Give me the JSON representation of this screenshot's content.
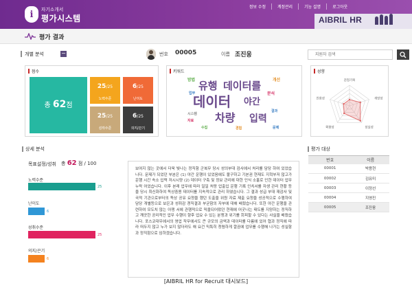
{
  "header": {
    "logo_sub": "자기소개서",
    "logo_main": "평가시스템",
    "nav": [
      "정보 수정",
      "계정관리",
      "기능 설명",
      "로그아웃"
    ],
    "brand": "AIBRIL HR",
    "brand_color": "#7a2f95"
  },
  "page": {
    "title": "평가 결과"
  },
  "individual": {
    "section_label": "개별 분석",
    "collapse_label": "−",
    "id_label": "번호",
    "id_value": "00005",
    "name_label": "이름",
    "name_value": "조진웅",
    "search_placeholder": "지원자 검색"
  },
  "score": {
    "title": "점수",
    "total_prefix": "총 ",
    "total": "62",
    "total_suffix": "점",
    "items": [
      {
        "value": "25",
        "max": "/25",
        "label": "노력수준",
        "color": "#f4a51d"
      },
      {
        "value": "6",
        "max": "/25",
        "label": "난이도",
        "color": "#f06a37"
      },
      {
        "value": "25",
        "max": "/25",
        "label": "성취수준",
        "color": "#c8a97a"
      },
      {
        "value": "6",
        "max": "/25",
        "label": "의지/끈기",
        "color": "#3c3c3c"
      }
    ]
  },
  "keyword": {
    "title": "키워드",
    "words": [
      {
        "text": "데이터",
        "size": 20,
        "color": "#6a4a8c"
      },
      {
        "text": "유행",
        "size": 15,
        "color": "#6a4a8c"
      },
      {
        "text": "데이터를",
        "size": 15,
        "color": "#6a4a8c"
      },
      {
        "text": "야간",
        "size": 13,
        "color": "#6a4a8c"
      },
      {
        "text": "차량",
        "size": 16,
        "color": "#6a4a8c"
      },
      {
        "text": "입력",
        "size": 14,
        "color": "#6a4a8c"
      },
      {
        "text": "방법",
        "size": 6,
        "color": "#5fae4c"
      },
      {
        "text": "개선",
        "size": 6,
        "color": "#e4922b"
      },
      {
        "text": "업무",
        "size": 5,
        "color": "#3b7fc4"
      },
      {
        "text": "분석",
        "size": 6,
        "color": "#d63a6c"
      },
      {
        "text": "시스템",
        "size": 5,
        "color": "#8c8c8c"
      },
      {
        "text": "수집",
        "size": 5,
        "color": "#5fae4c"
      },
      {
        "text": "결과",
        "size": 5,
        "color": "#3b7fc4"
      },
      {
        "text": "경험",
        "size": 5,
        "color": "#e4922b"
      },
      {
        "text": "자료",
        "size": 5,
        "color": "#d63a6c"
      },
      {
        "text": "문제",
        "size": 5,
        "color": "#3b7fc4"
      }
    ]
  },
  "personality": {
    "title": "성향",
    "axes": [
      "감정기복",
      "개방성",
      "성실성",
      "외향성",
      "친화성"
    ],
    "values": [
      0.3,
      0.55,
      0.9,
      0.45,
      0.3
    ]
  },
  "detail": {
    "title": "상세 분석",
    "goal_label": "목표설정/성취",
    "total_prefix": "총",
    "total": "62",
    "total_suffix": "점 / 100",
    "metrics": [
      {
        "label": "노력수준",
        "value": "25",
        "fraction": 1.0,
        "color": "#1a9e8f"
      },
      {
        "label": "난이도",
        "value": "6",
        "fraction": 0.24,
        "color": "#2f97d6"
      },
      {
        "label": "성취수준",
        "value": "25",
        "fraction": 1.0,
        "color": "#e0235f"
      },
      {
        "label": "의지/끈기",
        "value": "6",
        "fraction": 0.24,
        "color": "#f4821f"
      }
    ],
    "text": "보여지 않는 곳에서 더욱 빛나는 정직함 군복무 당시 성의부대 검사에서 처리를 담당 하여 있었습니다. 문제가 되었던 부분은 (1) 야간 운행이 있었음에도 불구하고 기본권 현재도 지혁부저 않고가 운행 시간 속소 입력 저시시양 (2) 데이터 구축 및 정보 관리에 대한 인식 소홀로 인한 데이터 업무 누락 어었습니다. 이후 본래 업무에 따라 일일 처랑 업출입 운행 기록 인치서를 자생 관리 현황 등을 당시 최신화하여 독상중용 데이터를 지속적으로 관리 하였습니다. 그 결과 성급 부대 재감사 및 국적 기관으로부터의 독상 공유 요청을 했던 도출을 위원 자료 제출 요청을 성공적으로 수행하여 담당 개별등으로 보은과 성취감 경직결과 부균함의 자부에 대해 배웠습니다. 또한 야간 운행을 관련하여 모도치 않는 아쟁 서에 관행적으로 믹을되어왔던 현재에 어굿나는 태도를 지양하는 정직하고 깨끗한 공리적인 업무 수행이 향후 업요 수 있는 분쟁과 위기를 회피할 수 있다는 사실을 배웠습니다. 포스코대우에서의 영업 작무에서도 큰 규모의 금액과 데이터를 다룸에 있어 협과 정직에 따라 떠두지 않고 누가 보지 않더라도 해 요건 믹특히 청렴하게 깔끔에 업무를 수행해 나가는 성실함과 정직함으로 임하겠습니다."
  },
  "targets": {
    "title": "평가 대상",
    "columns": [
      "번호",
      "이름"
    ],
    "rows": [
      [
        "00001",
        "박용현"
      ],
      [
        "00002",
        "김유미"
      ],
      [
        "00003",
        "이정선"
      ],
      [
        "00004",
        "지영진"
      ],
      [
        "00005",
        "조진웅"
      ]
    ],
    "selected_index": 4
  },
  "caption": "[AIBRIL HR for Recruit 대시보드]"
}
